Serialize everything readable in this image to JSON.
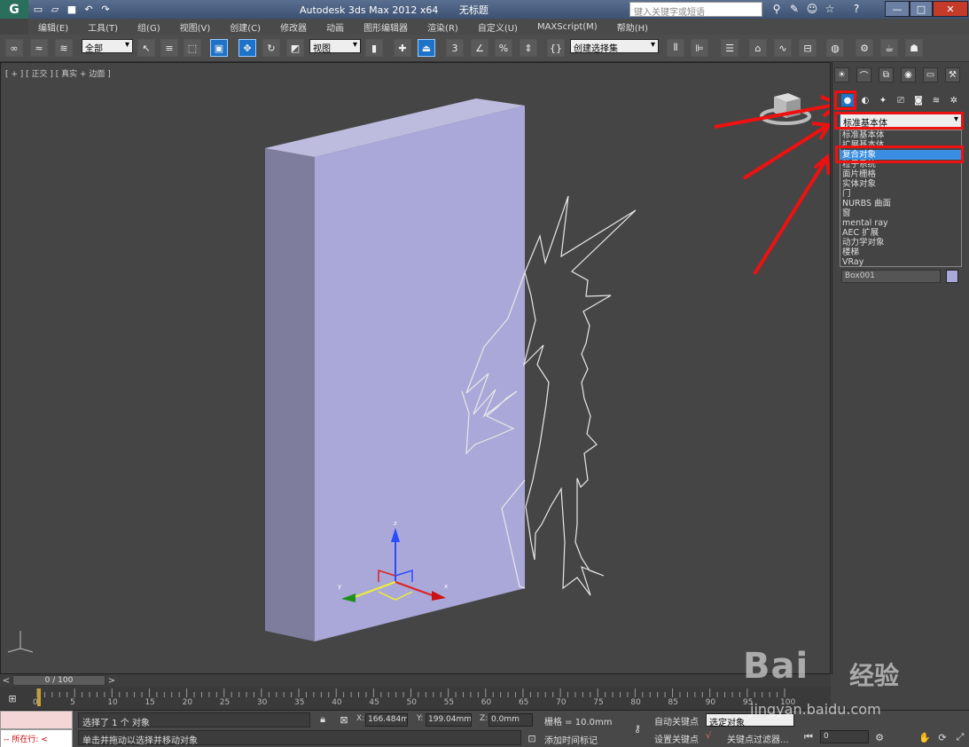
{
  "titlebar": {
    "logo_text": "G",
    "app_title": "Autodesk 3ds Max  2012 x64",
    "doc_title": "无标题",
    "search_placeholder": "键入关键字或短语",
    "icons": [
      "new-file-icon",
      "open-file-icon",
      "save-icon",
      "undo-icon",
      "redo-icon",
      "binoculars-icon",
      "tools-icon",
      "user-icon",
      "favorite-star-icon",
      "help-icon"
    ]
  },
  "menu": {
    "items": [
      "编辑(E)",
      "工具(T)",
      "组(G)",
      "视图(V)",
      "创建(C)",
      "修改器",
      "动画",
      "图形编辑器",
      "渲染(R)",
      "自定义(U)",
      "MAXScript(M)",
      "帮助(H)"
    ]
  },
  "toolbar": {
    "selection_filter": "全部",
    "ref_coord": "视图",
    "named_selection": "创建选择集",
    "snap_label": "3"
  },
  "viewport": {
    "label": "[ + ] [ 正交 ] [ 真实 + 边面 ]",
    "axis_x": "x",
    "axis_y": "y",
    "axis_z": "z"
  },
  "cmdpanel": {
    "type_select": "标准基本体",
    "options": [
      "标准基本体",
      "扩展基本体",
      "复合对象",
      "粒子系统",
      "面片栅格",
      "实体对象",
      "门",
      "NURBS 曲面",
      "窗",
      "mental ray",
      "AEC 扩展",
      "动力学对象",
      "楼梯",
      "VRay"
    ],
    "selected_option": "复合对象",
    "object_name": "Box001",
    "object_color": "#aaa8d8"
  },
  "timeline": {
    "frame_display": "0 / 100",
    "ticks": [
      "0",
      "5",
      "10",
      "15",
      "20",
      "25",
      "30",
      "35",
      "40",
      "45",
      "50",
      "55",
      "60",
      "65",
      "70",
      "75",
      "80",
      "85",
      "90",
      "95",
      "100"
    ]
  },
  "status": {
    "listener_text": "--  所在行:  <",
    "message": "选择了 1 个 对象",
    "prompt": "单击并拖动以选择并移动对象",
    "x_label": "X:",
    "x_value": "166.484mm",
    "y_label": "Y:",
    "y_value": "199.04mm",
    "z_label": "Z:",
    "z_value": "0.0mm",
    "grid": "栅格 = 10.0mm",
    "add_time_tag": "添加时间标记",
    "auto_key": "自动关键点",
    "set_key": "设置关键点",
    "selected_filter": "选定对象",
    "key_filters": "关键点过滤器...",
    "frame_value": "0"
  },
  "watermark": {
    "brand": "Bai",
    "brand_sub": "经验",
    "url": "jingyan.baidu.com"
  },
  "colors": {
    "annotation": "#ee1111",
    "selected_highlight": "#3a8de0",
    "box_front": "#aaa8d8",
    "box_side": "#7f7d9e",
    "box_top": "#bebcde"
  }
}
